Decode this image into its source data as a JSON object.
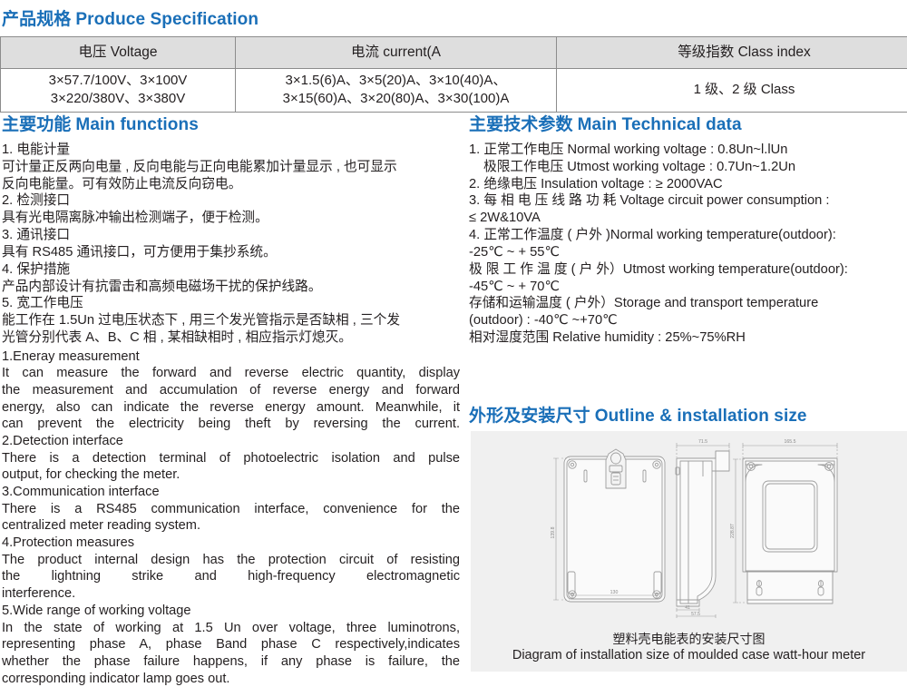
{
  "spec_section": {
    "heading_cn": "产品规格",
    "heading_en": "Produce Specification",
    "table": {
      "headers": [
        "电压 Voltage",
        "电流 current(A",
        "等级指数 Class index"
      ],
      "rows": [
        {
          "voltage": [
            "3×57.7/100V、3×100V",
            "3×220/380V、3×380V"
          ],
          "current": [
            "3×1.5(6)A、3×5(20)A、3×10(40)A、",
            "3×15(60)A、3×20(80)A、3×30(100)A"
          ],
          "class_index": [
            "1 级、2 级 Class"
          ]
        }
      ]
    }
  },
  "functions_section": {
    "heading_cn": "主要功能",
    "heading_en": "Main functions",
    "cn_lines": [
      "1. 电能计量",
      "可计量正反两向电量 , 反向电能与正向电能累加计量显示 , 也可显示",
      "反向电能量。可有效防止电流反向窃电。",
      "2. 检测接口",
      "具有光电隔离脉冲输出检测端子，便于检测。",
      "3. 通讯接口",
      "具有 RS485 通讯接口，可方便用于集抄系统。",
      "4. 保护措施",
      "产品内部设计有抗雷击和高频电磁场干扰的保护线路。",
      "5. 宽工作电压",
      "能工作在 1.5Un 过电压状态下 , 用三个发光管指示是否缺相 , 三个发",
      "光管分别代表 A、B、C 相 , 某相缺相时 , 相应指示灯熄灭。"
    ],
    "en_lines": [
      "1.Eneray measurement",
      "It can measure the forward and reverse electric quantity, display",
      "the measurement and accumulation of reverse energy and forward",
      "energy, also can indicate the reverse energy amount. Meanwhile, it",
      "can prevent the electricity being theft by reversing the current.",
      "2.Detection interface",
      "There is a detection terminal of photoelectric isolation and pulse",
      "output, for checking the meter.",
      "3.Communication interface",
      "There is a RS485 communication interface, convenience for the",
      "centralized meter reading system.",
      "4.Protection measures",
      "The product internal design has the protection circuit of resisting",
      "the lightning strike and high-frequency electromagnetic",
      "interference.",
      "5.Wide range of working voltage",
      "In the state of working at 1.5 Un over voltage, three luminotrons,",
      "representing phase A, phase Band phase C respectively,indicates",
      "whether the phase failure happens, if any phase is failure, the",
      "corresponding indicator lamp goes out."
    ]
  },
  "technical_section": {
    "heading_cn": "主要技术参数",
    "heading_en": "Main Technical data",
    "lines": [
      "1. 正常工作电压 Normal working voltage : 0.8Un~l.lUn",
      "极限工作电压 Utmost working voltage : 0.7Un~1.2Un",
      "2. 绝缘电压 Insulation voltage : ≥ 2000VAC",
      "3. 每 相 电 压 线 路 功 耗 Voltage circuit power consumption :",
      "≤ 2W&10VA",
      "4. 正常工作温度 ( 户外 )Normal working temperature(outdoor):",
      "-25℃ ~ + 55℃",
      "极 限 工 作 温 度 ( 户 外）Utmost working temperature(outdoor):",
      "-45℃ ~ + 70℃",
      "存储和运输温度 ( 户外）Storage and transport temperature",
      "(outdoor) : -40℃ ~+70℃",
      "相对湿度范围 Relative humidity : 25%~75%RH"
    ]
  },
  "outline_section": {
    "heading_cn": "外形及安装尺寸",
    "heading_en": "Outline & installation size",
    "diagram": {
      "caption_cn": "塑料壳电能表的安装尺寸图",
      "caption_en": "Diagram of installation size of moulded case watt-hour meter",
      "dimensions": {
        "front_height": "139.8",
        "front_width": "130",
        "side_width": "71.5",
        "side_bottom_a": "41",
        "side_bottom_b": "57.5",
        "back_width": "165.5",
        "back_height": "228.87"
      }
    }
  },
  "colors": {
    "heading_blue": "#1a6fb8",
    "table_header_bg": "#dedede",
    "table_border": "#8c8c8c",
    "panel_bg": "#f0f0f0",
    "body_text": "#231f20",
    "drawing_line": "#9a9a9a"
  }
}
